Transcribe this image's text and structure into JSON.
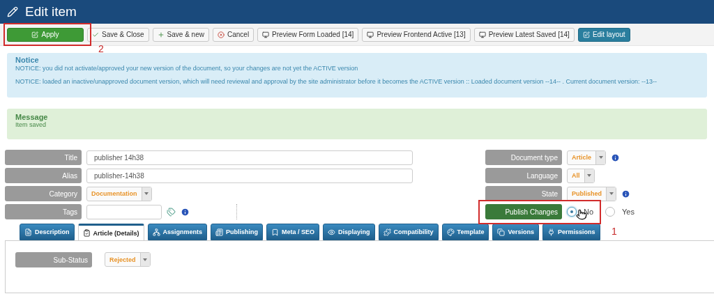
{
  "header": {
    "title": "Edit item"
  },
  "toolbar": [
    {
      "label": "Apply",
      "kind": "success"
    },
    {
      "label": "Save & Close",
      "kind": "default"
    },
    {
      "label": "Save & new",
      "kind": "default"
    },
    {
      "label": "Cancel",
      "kind": "default"
    },
    {
      "label": "Preview Form Loaded [14]",
      "kind": "default"
    },
    {
      "label": "Preview Frontend Active [13]",
      "kind": "default"
    },
    {
      "label": "Preview Latest Saved [14]",
      "kind": "default"
    },
    {
      "label": "Edit layout",
      "kind": "info"
    }
  ],
  "notice": {
    "heading": "Notice",
    "lines": [
      "NOTICE: you did not activate/approved your new version of the document, so your changes are not yet the ACTIVE version",
      "NOTICE: loaded an inactive/unapproved document version, which will need reviewal and approval by the site administrator before it becomes the ACTIVE version :: Loaded document version --14-- . Current document version: --13--"
    ]
  },
  "message": {
    "heading": "Message",
    "text": "Item saved"
  },
  "left_fields": [
    {
      "label": "Title",
      "kind": "text",
      "value": "publisher 14h38"
    },
    {
      "label": "Alias",
      "kind": "text",
      "value": "publisher-14h38"
    },
    {
      "label": "Category",
      "kind": "select",
      "value": "Documentation"
    },
    {
      "label": "Tags",
      "kind": "tags"
    }
  ],
  "right_fields": [
    {
      "label": "Document type",
      "kind": "select",
      "value": "Article",
      "info": true
    },
    {
      "label": "Language",
      "kind": "select",
      "value": "All",
      "info": false
    },
    {
      "label": "State",
      "kind": "select",
      "value": "Published",
      "info": true
    },
    {
      "label": "Publish Changes",
      "kind": "radio",
      "info": false,
      "options": [
        {
          "label": "No",
          "selected": true
        },
        {
          "label": "Yes",
          "selected": false
        }
      ]
    }
  ],
  "tabs": [
    {
      "label": "Description",
      "selected": false
    },
    {
      "label": "Article (Details)",
      "selected": true
    },
    {
      "label": "Assignments",
      "selected": false
    },
    {
      "label": "Publishing",
      "selected": false
    },
    {
      "label": "Meta / SEO",
      "selected": false
    },
    {
      "label": "Displaying",
      "selected": false
    },
    {
      "label": "Compatibility",
      "selected": false
    },
    {
      "label": "Template",
      "selected": false
    },
    {
      "label": "Versions",
      "selected": false
    },
    {
      "label": "Permissions",
      "selected": false
    }
  ],
  "panel": {
    "fields": [
      {
        "label": "Sub-Status",
        "value": "Rejected"
      }
    ]
  },
  "annotations": [
    {
      "label": "2"
    },
    {
      "label": "1"
    }
  ]
}
